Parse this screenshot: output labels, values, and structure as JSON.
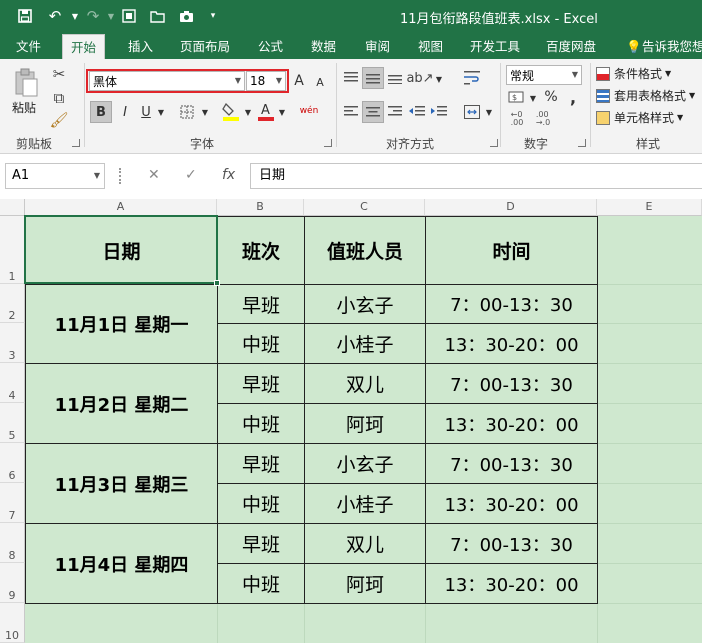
{
  "title": "11月包衔路段值班表.xlsx - Excel",
  "tabs": [
    "文件",
    "开始",
    "插入",
    "页面布局",
    "公式",
    "数据",
    "审阅",
    "视图",
    "开发工具",
    "百度网盘",
    "告诉我您想"
  ],
  "ribbon": {
    "clipboard": {
      "paste": "粘贴",
      "label": "剪贴板"
    },
    "font": {
      "family": "黑体",
      "size": "18",
      "label": "字体",
      "grow": "A",
      "shrink": "A",
      "bold": "B",
      "italic": "I",
      "underline": "U",
      "phonetic": "wén"
    },
    "alignment": {
      "label": "对齐方式"
    },
    "number": {
      "format": "常规",
      "label": "数字",
      "percent": "%",
      "comma": ","
    },
    "styles": {
      "conditional": "条件格式",
      "table": "套用表格格式",
      "cell": "单元格样式",
      "label": "样式"
    }
  },
  "formula_bar": {
    "name_box": "A1",
    "fx": "fx",
    "content": "日期"
  },
  "columns": [
    "A",
    "B",
    "C",
    "D",
    "E"
  ],
  "rows": [
    "1",
    "2",
    "3",
    "4",
    "5",
    "6",
    "7",
    "8",
    "9",
    "10"
  ],
  "table": {
    "headers": [
      "日期",
      "班次",
      "值班人员",
      "时间"
    ],
    "days": [
      {
        "date": "11月1日  星期一",
        "shifts": [
          {
            "shift": "早班",
            "person": "小玄子",
            "time": "7：00-13：30"
          },
          {
            "shift": "中班",
            "person": "小桂子",
            "time": "13：30-20：00"
          }
        ]
      },
      {
        "date": "11月2日  星期二",
        "shifts": [
          {
            "shift": "早班",
            "person": "双儿",
            "time": "7：00-13：30"
          },
          {
            "shift": "中班",
            "person": "阿珂",
            "time": "13：30-20：00"
          }
        ]
      },
      {
        "date": "11月3日  星期三",
        "shifts": [
          {
            "shift": "早班",
            "person": "小玄子",
            "time": "7：00-13：30"
          },
          {
            "shift": "中班",
            "person": "小桂子",
            "time": "13：30-20：00"
          }
        ]
      },
      {
        "date": "11月4日  星期四",
        "shifts": [
          {
            "shift": "早班",
            "person": "双儿",
            "time": "7：00-13：30"
          },
          {
            "shift": "中班",
            "person": "阿珂",
            "time": "13：30-20：00"
          }
        ]
      }
    ]
  },
  "colors": {
    "excel_green": "#217346",
    "sheet_fill": "#cfe8cf",
    "highlight_box": "#e0252b"
  }
}
